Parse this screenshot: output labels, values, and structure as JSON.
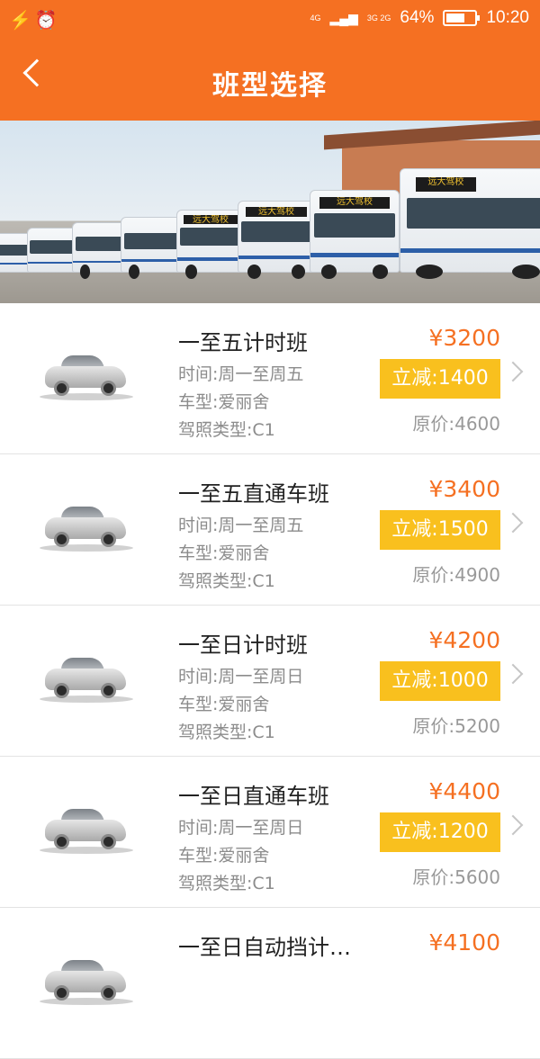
{
  "status_bar": {
    "network_1": "4G",
    "network_2": "3G 2G",
    "battery_percent": "64%",
    "battery_level": 0.64,
    "time": "10:20",
    "icons": [
      "alarm-icon",
      "sync-icon",
      "signal-icon",
      "battery-icon"
    ]
  },
  "header": {
    "title": "班型选择",
    "back_icon": "chevron-left-icon"
  },
  "banner": {
    "bus_sign": "远大驾校"
  },
  "courses": [
    {
      "name": "一至五计时班",
      "time": "时间:周一至周五",
      "car_model": "车型:爱丽舍",
      "license": "驾照类型:C1",
      "price": "¥3200",
      "discount": "立减:1400",
      "original": "原价:4600"
    },
    {
      "name": "一至五直通车班",
      "time": "时间:周一至周五",
      "car_model": "车型:爱丽舍",
      "license": "驾照类型:C1",
      "price": "¥3400",
      "discount": "立减:1500",
      "original": "原价:4900"
    },
    {
      "name": "一至日计时班",
      "time": "时间:周一至周日",
      "car_model": "车型:爱丽舍",
      "license": "驾照类型:C1",
      "price": "¥4200",
      "discount": "立减:1000",
      "original": "原价:5200"
    },
    {
      "name": "一至日直通车班",
      "time": "时间:周一至周日",
      "car_model": "车型:爱丽舍",
      "license": "驾照类型:C1",
      "price": "¥4400",
      "discount": "立减:1200",
      "original": "原价:5600"
    },
    {
      "name": "一至日自动挡计…",
      "time": "",
      "car_model": "",
      "license": "",
      "price": "¥4100",
      "discount": "",
      "original": ""
    }
  ],
  "colors": {
    "accent": "#f57022",
    "discount_bg": "#f9c01e",
    "detail_text": "#8c8c8c"
  }
}
